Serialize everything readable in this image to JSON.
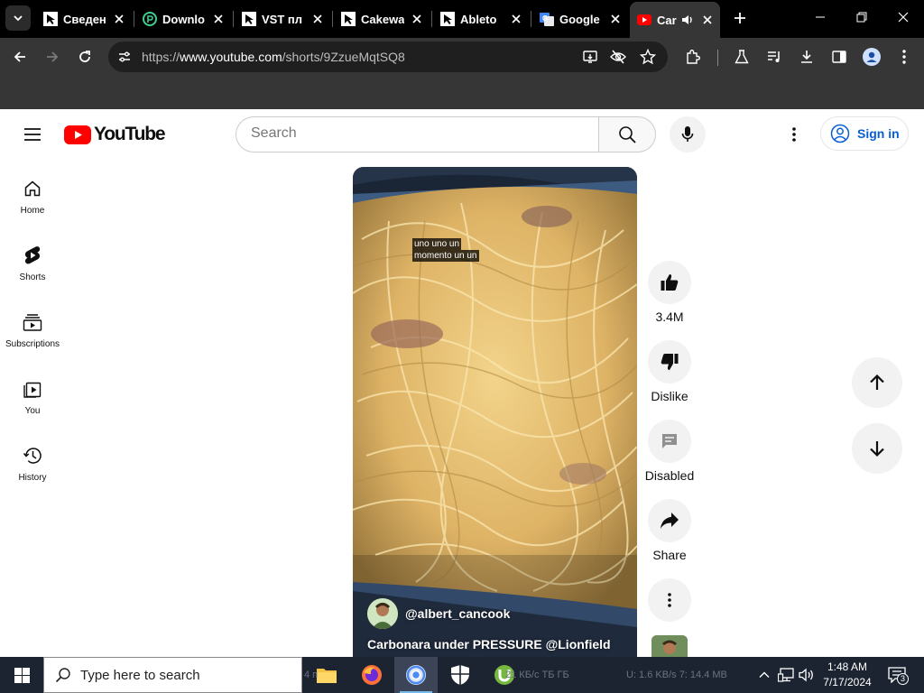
{
  "browser": {
    "tabs": [
      {
        "label": "Сведен",
        "icon": "cursor-icon"
      },
      {
        "label": "Downlo",
        "icon": "download-site-icon"
      },
      {
        "label": "VST пл",
        "icon": "cursor-icon"
      },
      {
        "label": "Cakewa",
        "icon": "cursor-icon"
      },
      {
        "label": "Ableto",
        "icon": "cursor-icon"
      },
      {
        "label": "Google",
        "icon": "google-translate-icon"
      },
      {
        "label": "Car",
        "icon": "youtube-icon",
        "active": true,
        "audio": true
      }
    ],
    "url": {
      "scheme": "https://",
      "host": "www.youtube.com",
      "path": "/shorts/9ZzueMqtSQ8"
    }
  },
  "youtube": {
    "logo_text": "YouTube",
    "search_placeholder": "Search",
    "signin_label": "Sign in",
    "sidebar": [
      {
        "label": "Home",
        "icon": "home-icon"
      },
      {
        "label": "Shorts",
        "icon": "shorts-icon"
      },
      {
        "label": "Subscriptions",
        "icon": "subscriptions-icon"
      },
      {
        "label": "You",
        "icon": "you-icon"
      },
      {
        "label": "History",
        "icon": "history-icon"
      }
    ],
    "short": {
      "caption_line1": "uno uno un",
      "caption_line2": "momento un un",
      "channel": "@albert_cancook",
      "title": "Carbonara under PRESSURE @Lionfield"
    },
    "actions": {
      "like_count": "3.4M",
      "dislike_label": "Dislike",
      "comments_label": "Disabled",
      "share_label": "Share"
    }
  },
  "taskbar": {
    "search_placeholder": "Type here to search",
    "clock_time": "1:48 AM",
    "clock_date": "7/17/2024",
    "notification_count": "3",
    "ghost_text_1": "4 п",
    "ghost_text_2": "21 КБ/с   ТБ ГБ",
    "ghost_text_3": "U: 1.6 KB/s  7: 14.4 MB"
  },
  "colors": {
    "yt_red": "#ff0000",
    "signin_blue": "#065fd4",
    "browser_dark": "#363636",
    "taskbar": "#1c2431"
  }
}
